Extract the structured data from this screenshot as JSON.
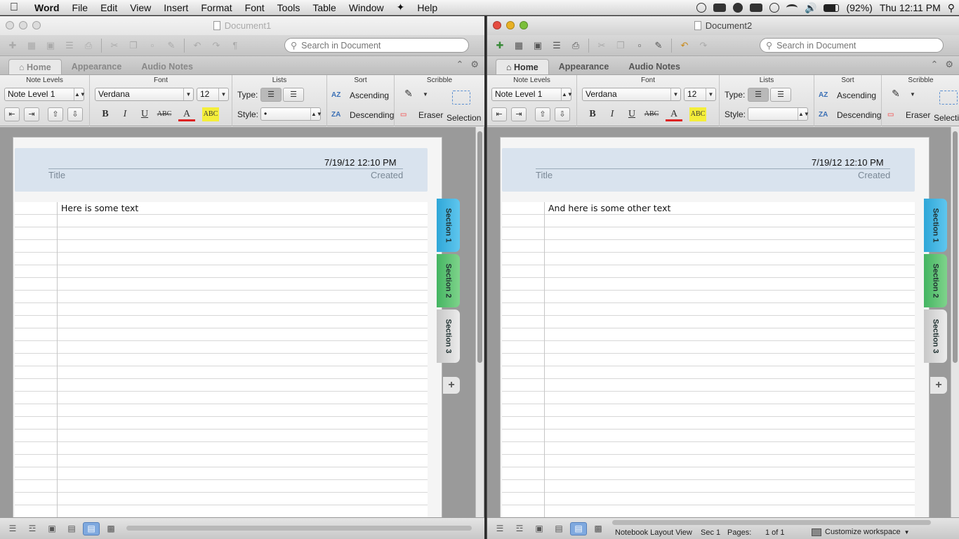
{
  "menubar": {
    "app": "Word",
    "items": [
      "File",
      "Edit",
      "View",
      "Insert",
      "Format",
      "Font",
      "Tools",
      "Table",
      "Window",
      "Help"
    ],
    "battery": "(92%)",
    "clock": "Thu 12:11 PM"
  },
  "windows": [
    {
      "title": "Document1",
      "search_placeholder": "Search in Document",
      "tabs": [
        "Home",
        "Appearance",
        "Audio Notes"
      ],
      "ribbon": {
        "groups": [
          "Note Levels",
          "Font",
          "Lists",
          "Sort",
          "Scribble"
        ],
        "note_level": "Note Level 1",
        "font_name": "Verdana",
        "font_size": "12",
        "type_label": "Type:",
        "style_label": "Style:",
        "style_value": "•",
        "ascending": "Ascending",
        "descending": "Descending",
        "eraser": "Eraser",
        "selection": "Selection"
      },
      "page": {
        "date": "7/19/12 12:10 PM",
        "title_label": "Title",
        "created_label": "Created",
        "text": "Here is some text"
      },
      "sections": [
        "Section 1",
        "Section 2",
        "Section 3"
      ]
    },
    {
      "title": "Document2",
      "search_placeholder": "Search in Document",
      "tabs": [
        "Home",
        "Appearance",
        "Audio Notes"
      ],
      "ribbon": {
        "groups": [
          "Note Levels",
          "Font",
          "Lists",
          "Sort",
          "Scribble"
        ],
        "note_level": "Note Level 1",
        "font_name": "Verdana",
        "font_size": "12",
        "type_label": "Type:",
        "style_label": "Style:",
        "style_value": "",
        "ascending": "Ascending",
        "descending": "Descending",
        "eraser": "Eraser",
        "selection": "Selectio"
      },
      "page": {
        "date": "7/19/12 12:10 PM",
        "title_label": "Title",
        "created_label": "Created",
        "text": "And here is some other text"
      },
      "sections": [
        "Section 1",
        "Section 2",
        "Section 3"
      ],
      "status": {
        "view": "Notebook Layout View",
        "section": "Sec 1",
        "pages_label": "Pages:",
        "pages_value": "1 of 1",
        "customize": "Customize workspace"
      }
    }
  ]
}
